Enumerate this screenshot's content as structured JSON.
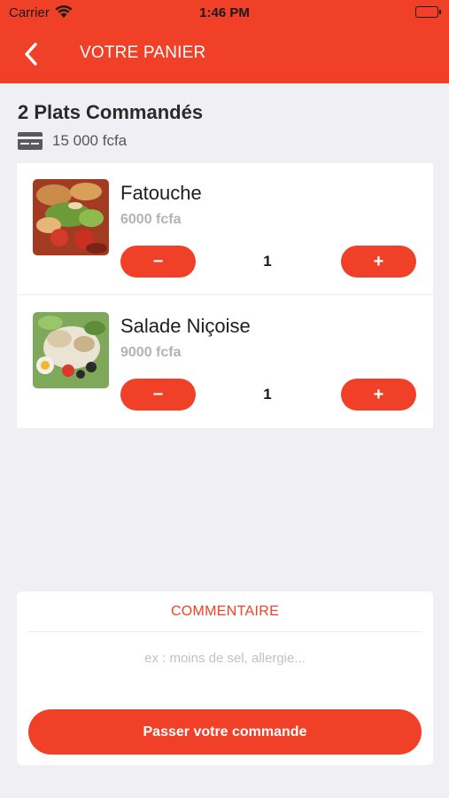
{
  "status_bar": {
    "carrier": "Carrier",
    "time": "1:46 PM"
  },
  "header": {
    "title": "VOTRE PANIER"
  },
  "summary": {
    "title": "2 Plats Commandés",
    "total": "15 000 fcfa"
  },
  "cart": {
    "items": [
      {
        "name": "Fatouche",
        "price": "6000 fcfa",
        "quantity": "1",
        "minus_label": "−",
        "plus_label": "+"
      },
      {
        "name": "Salade Niçoise",
        "price": "9000 fcfa",
        "quantity": "1",
        "minus_label": "−",
        "plus_label": "+"
      }
    ]
  },
  "comment": {
    "label": "COMMENTAIRE",
    "placeholder": "ex : moins de sel, allergie...",
    "submit_label": "Passer votre commande"
  },
  "colors": {
    "accent": "#f04128",
    "background": "#f0f0f4"
  }
}
